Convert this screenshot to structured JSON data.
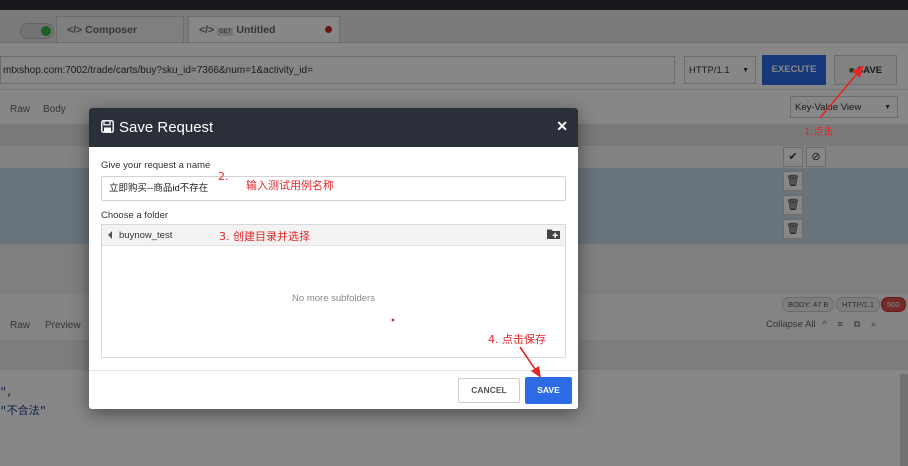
{
  "tabs": [
    {
      "icon": "code-icon",
      "label": "Composer"
    },
    {
      "icon": "code-icon",
      "method": "GET",
      "label": "Untitled"
    }
  ],
  "request": {
    "url": "mtxshop.com:7002/trade/carts/buy?sku_id=7366&num=1&activity_id=",
    "protocol": "HTTP/1.1",
    "execute_label": "EXECUTE",
    "save_label": "SAVE"
  },
  "request_tabs": [
    "Raw",
    "Body"
  ],
  "view_mode": "Key-Value View",
  "response": {
    "body_size": "BODY: 47 B",
    "protocol": "HTTP/1.1",
    "status": "500",
    "tabs": [
      "Raw",
      "Preview"
    ],
    "collapse_label": "Collapse All",
    "code_lines": [
      "\",",
      "\"不合法\""
    ]
  },
  "modal": {
    "title": "Save Request",
    "name_label": "Give your request a name",
    "name_value": "立即购买--商品id不存在",
    "folder_label": "Choose a folder",
    "folder_name": "buynow_test",
    "empty_text": "No more subfolders",
    "cancel_label": "CANCEL",
    "save_label": "SAVE"
  },
  "annotations": {
    "step1": "1.点击",
    "step2": "2.",
    "step2_text": "输入测试用例名称",
    "step3": "3. 创建目录并选择",
    "step4": "4. 点击保存"
  },
  "colors": {
    "accent": "#2d6be5",
    "header_dark": "#2b2f3a",
    "annotation_red": "#e0282a",
    "error_badge": "#d9534f"
  }
}
